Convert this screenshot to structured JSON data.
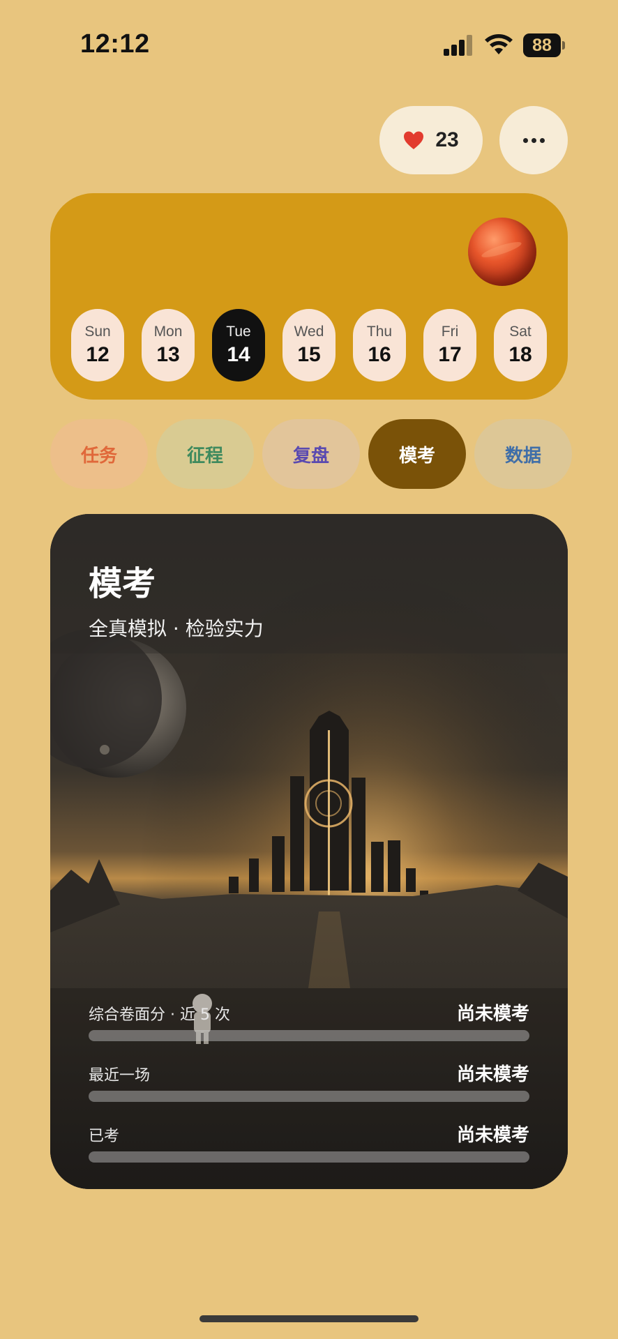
{
  "status_bar": {
    "time": "12:12",
    "battery": "88"
  },
  "header": {
    "likes_count": "23",
    "like_icon": "heart-icon",
    "more_icon": "more-dots-icon"
  },
  "calendar": {
    "days": [
      {
        "name": "Sun",
        "date": "12",
        "selected": false
      },
      {
        "name": "Mon",
        "date": "13",
        "selected": false
      },
      {
        "name": "Tue",
        "date": "14",
        "selected": true
      },
      {
        "name": "Wed",
        "date": "15",
        "selected": false
      },
      {
        "name": "Thu",
        "date": "16",
        "selected": false
      },
      {
        "name": "Fri",
        "date": "17",
        "selected": false
      },
      {
        "name": "Sat",
        "date": "18",
        "selected": false
      }
    ]
  },
  "tabs": [
    {
      "label": "任务"
    },
    {
      "label": "征程"
    },
    {
      "label": "复盘"
    },
    {
      "label": "模考",
      "active": true
    },
    {
      "label": "数据"
    }
  ],
  "exam_card": {
    "title": "模考",
    "subtitle": "全真模拟 · 检验实力",
    "stats": [
      {
        "label": "综合卷面分 · 近 5 次",
        "value": "尚未模考",
        "progress": 0
      },
      {
        "label": "最近一场",
        "value": "尚未模考",
        "progress": 0
      },
      {
        "label": "已考",
        "value": "尚未模考",
        "progress": 0
      }
    ]
  },
  "colors": {
    "background": "#e8c57e",
    "calendar_card": "#d49a17",
    "active_tab": "#7a5208",
    "heart": "#e23b2e"
  }
}
